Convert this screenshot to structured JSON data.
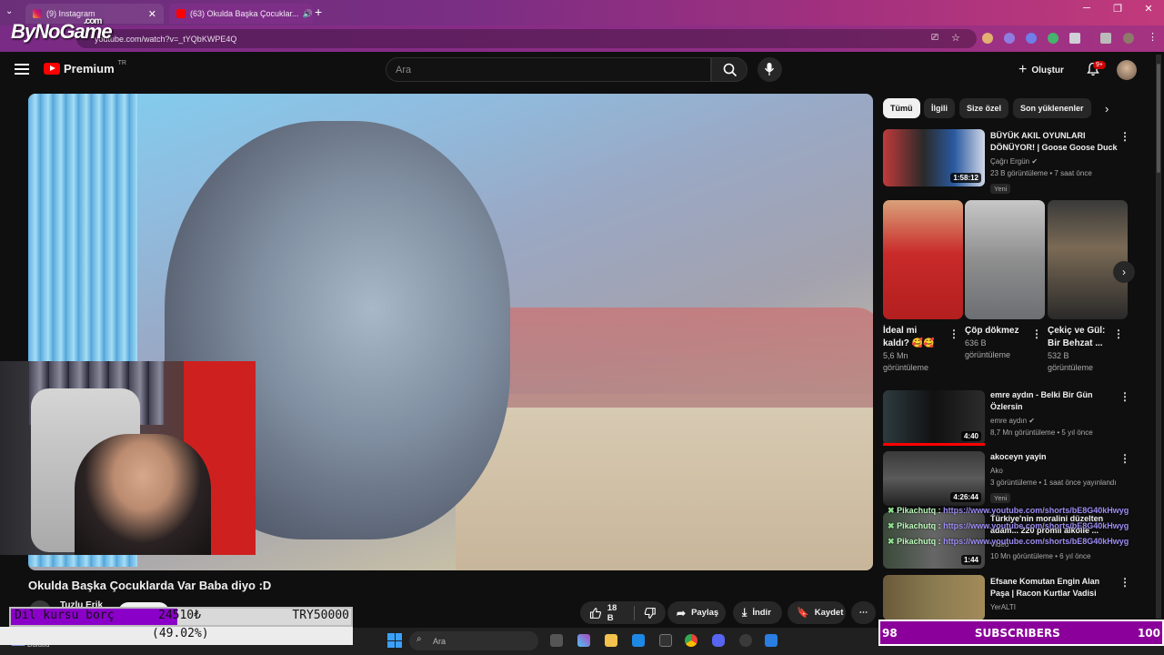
{
  "browser": {
    "tabs": [
      {
        "label": "(9) Instagram"
      },
      {
        "label": "(63) Okulda Başka Çocuklar..."
      }
    ],
    "url": "youtube.com/watch?v=_tYQbKWPE4Q",
    "watermark": "ByNoGame",
    "watermark_suffix": ".com"
  },
  "youtube": {
    "brand": "Premium",
    "brand_sup": "TR",
    "search_placeholder": "Ara",
    "create_label": "Oluştur",
    "notif_badge": "9+"
  },
  "video": {
    "title": "Okulda Başka Çocuklarda Var Baba diyo :D",
    "channel": "Tuzlu Erik",
    "likes": "18 B",
    "share_label": "Paylaş",
    "download_label": "İndir",
    "save_label": "Kaydet"
  },
  "chips": [
    "Tümü",
    "İlgili",
    "Size özel",
    "Son yüklenenler"
  ],
  "related": [
    {
      "title_l1": "BÜYÜK AKIL OYUNLARI",
      "title_l2": "DÖNÜYOR! | Goose Goose Duck",
      "channel": "Çağrı Ergün",
      "meta": "23 B görüntüleme • 7 saat önce",
      "badge": "Yeni",
      "duration": "1:58:12"
    },
    {
      "title_l1": "emre aydın - Belki Bir Gün",
      "title_l2": "Özlersin",
      "channel": "emre aydın",
      "meta": "8,7 Mn görüntüleme • 5 yıl önce",
      "duration": "4:40"
    },
    {
      "title_l1": "akoceyn yayin",
      "title_l2": "",
      "channel": "Ako",
      "meta": "3 görüntüleme • 1 saat önce yayınlandı",
      "badge": "Yeni",
      "duration": "4:26:44"
    },
    {
      "title_l1": "Türkiye'nin moralini düzelten",
      "title_l2": "adam... 220 promil alkolle ...",
      "channel": "Video",
      "meta": "10 Mn görüntüleme • 6 yıl önce",
      "duration": "1:44"
    },
    {
      "title_l1": "Efsane Komutan Engin Alan",
      "title_l2": "Paşa | Racon Kurtlar Vadisi",
      "channel": "YerALTI",
      "meta": ""
    }
  ],
  "shorts": [
    {
      "title_l1": "İdeal mi",
      "title_l2": "kaldı? 🥰🥰",
      "views_l1": "5,6 Mn",
      "views_l2": "görüntüleme"
    },
    {
      "title_l1": "Çöp dökmez",
      "title_l2": "",
      "views_l1": "636 B",
      "views_l2": "görüntüleme"
    },
    {
      "title_l1": "Çekiç ve Gül:",
      "title_l2": "Bir Behzat ...",
      "views_l1": "532 B",
      "views_l2": "görüntüleme"
    }
  ],
  "chat": [
    {
      "user": "Pikachutq :",
      "msg": "https://www.youtube.com/shorts/bE8G40kHwyg"
    },
    {
      "user": "Pikachutq :",
      "msg": "https://www.youtube.com/shorts/bE8G40kHwyg"
    },
    {
      "user": "Pikachutq :",
      "msg": "https://www.youtube.com/shorts/bE8G40kHwyg"
    }
  ],
  "donation": {
    "label": "Dil kursu borç",
    "amount": "24510₺",
    "goal": "TRY50000",
    "percent": "(49.02%)",
    "fill_fraction": 0.4902
  },
  "subscribers": {
    "current": "98",
    "label": "SUBSCRIBERS",
    "target": "100",
    "fraction": 0.98
  },
  "taskbar": {
    "search_placeholder": "Ara",
    "weather": "Bulutlu"
  },
  "colors": {
    "brand_red": "#ff0000",
    "overlay_purple": "#8b00c9",
    "chat_green": "#8fe08f"
  }
}
